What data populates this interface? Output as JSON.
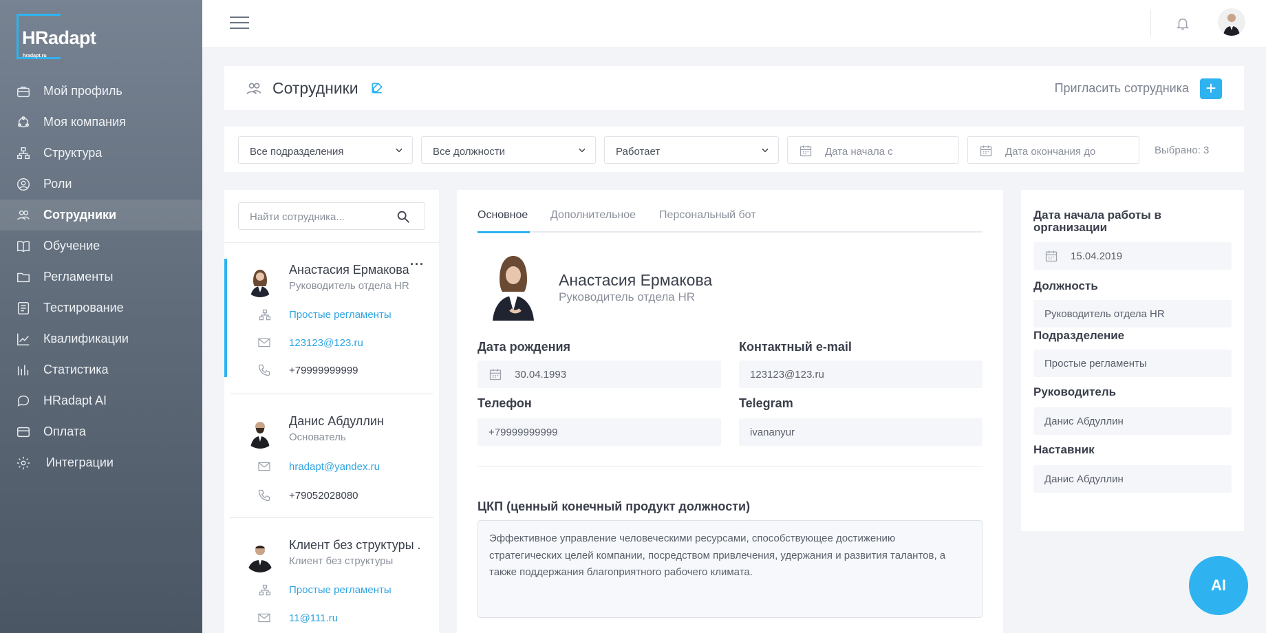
{
  "brand": {
    "logo_hr": "HR",
    "logo_adapt": "adapt",
    "logo_sub": "hradapt.ru",
    "accent": "#2fb3f0"
  },
  "sidebar": {
    "items": [
      {
        "label": "Мой профиль",
        "icon": "briefcase-icon"
      },
      {
        "label": "Моя компания",
        "icon": "company-icon"
      },
      {
        "label": "Структура",
        "icon": "structure-icon"
      },
      {
        "label": "Роли",
        "icon": "user-circle-icon"
      },
      {
        "label": "Сотрудники",
        "icon": "users-icon",
        "active": true
      },
      {
        "label": "Обучение",
        "icon": "book-icon"
      },
      {
        "label": "Регламенты",
        "icon": "folder-icon"
      },
      {
        "label": "Тестирование",
        "icon": "checklist-icon"
      },
      {
        "label": "Квалификации",
        "icon": "trend-icon"
      },
      {
        "label": "Статистика",
        "icon": "bars-icon"
      },
      {
        "label": "HRadapt AI",
        "icon": "chat-icon"
      },
      {
        "label": "Оплата",
        "icon": "card-icon"
      },
      {
        "label": "Интеграции",
        "icon": "gear-icon"
      }
    ]
  },
  "header": {
    "title": "Сотрудники",
    "invite_label": "Пригласить сотрудника",
    "invite_button": "+"
  },
  "filters": {
    "department": "Все подразделения",
    "position": "Все должности",
    "status": "Работает",
    "date_from_placeholder": "Дата начала с",
    "date_to_placeholder": "Дата окончания до",
    "selected_count": "Выбрано: 3"
  },
  "search": {
    "placeholder": "Найти сотрудника..."
  },
  "employees": [
    {
      "name": "Анастасия Ермакова",
      "role": "Руководитель отдела HR",
      "department": "Простые регламенты",
      "email": "123123@123.ru",
      "phone": "+79999999999"
    },
    {
      "name": "Данис Абдуллин",
      "role": "Основатель",
      "email": "hradapt@yandex.ru",
      "phone": "+79052028080"
    },
    {
      "name": "Клиент без структуры .",
      "role": "Клиент без структуры",
      "department": "Простые регламенты",
      "email": "11@111.ru"
    }
  ],
  "detail": {
    "tabs": [
      "Основное",
      "Дополнительное",
      "Персональный бот"
    ],
    "name": "Анастасия Ермакова",
    "role": "Руководитель отдела HR",
    "birth_label": "Дата рождения",
    "birth_value": "30.04.1993",
    "email_label": "Контактный e-mail",
    "email_value": "123123@123.ru",
    "phone_label": "Телефон",
    "phone_value": "+79999999999",
    "telegram_label": "Telegram",
    "telegram_value": "ivananyur",
    "ckp_label": "ЦКП (ценный конечный продукт должности)",
    "ckp_value": "Эффективное управление человеческими ресурсами, способствующее достижению стратегических целей компании, посредством привлечения, удержания и развития талантов, а также поддержания благоприятного рабочего климата."
  },
  "side": {
    "start_label": "Дата начала работы в организации",
    "start_value": "15.04.2019",
    "position_label": "Должность",
    "position_value": "Руководитель отдела HR",
    "department_label": "Подразделение",
    "department_value": "Простые регламенты",
    "manager_label": "Руководитель",
    "manager_value": "Данис Абдуллин",
    "mentor_label": "Наставник",
    "mentor_value": "Данис Абдуллин"
  },
  "ai_button": "AI"
}
